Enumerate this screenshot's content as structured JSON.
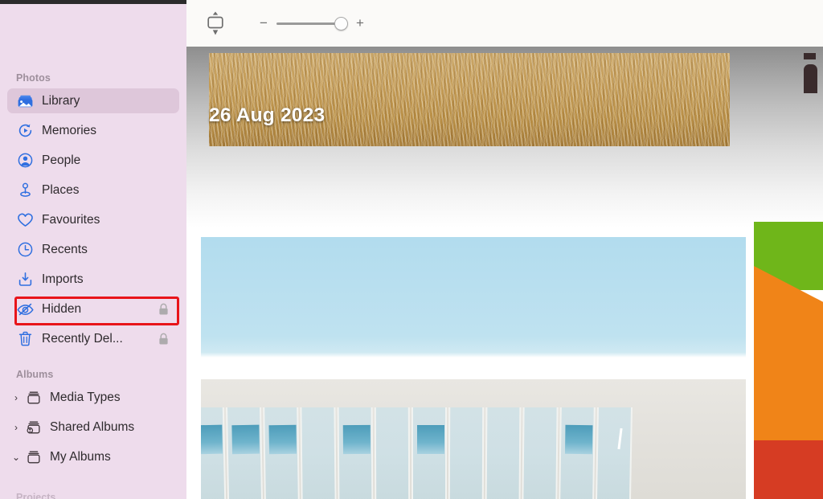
{
  "app": {
    "name": "Photos"
  },
  "sidebar": {
    "sections": [
      {
        "title": "Photos",
        "items": [
          {
            "label": "Library",
            "icon": "library-icon",
            "selected": true,
            "locked": false
          },
          {
            "label": "Memories",
            "icon": "memories-icon",
            "selected": false,
            "locked": false
          },
          {
            "label": "People",
            "icon": "people-icon",
            "selected": false,
            "locked": false
          },
          {
            "label": "Places",
            "icon": "places-icon",
            "selected": false,
            "locked": false
          },
          {
            "label": "Favourites",
            "icon": "heart-icon",
            "selected": false,
            "locked": false
          },
          {
            "label": "Recents",
            "icon": "clock-icon",
            "selected": false,
            "locked": false
          },
          {
            "label": "Imports",
            "icon": "import-icon",
            "selected": false,
            "locked": false
          },
          {
            "label": "Hidden",
            "icon": "eye-slash-icon",
            "selected": false,
            "locked": true
          },
          {
            "label": "Recently Del...",
            "icon": "trash-icon",
            "selected": false,
            "locked": true
          }
        ]
      },
      {
        "title": "Albums",
        "items": [
          {
            "label": "Media Types",
            "icon": "album-icon",
            "chevron": "›",
            "expanded": false
          },
          {
            "label": "Shared Albums",
            "icon": "shared-album-icon",
            "chevron": "›",
            "expanded": false
          },
          {
            "label": "My Albums",
            "icon": "album-icon",
            "chevron": "⌄",
            "expanded": true
          }
        ]
      }
    ],
    "partial_next_section": "Projects"
  },
  "toolbar": {
    "aspect_button_name": "zoom-level-stepper",
    "zoom_out_label": "−",
    "zoom_in_label": "+",
    "slider_value": 82
  },
  "content": {
    "photos": [
      {
        "name": "wheat-field-photo",
        "date_label": "26 Aug 2023"
      },
      {
        "name": "brick-building-photo",
        "date_label": ""
      },
      {
        "name": "modern-building-photo",
        "date_label": ""
      },
      {
        "name": "colour-blocks-photo",
        "date_label": ""
      }
    ],
    "date_label": "26 Aug 2023"
  },
  "annotation": {
    "target": "Hidden",
    "box_color": "#e8141a"
  },
  "colors": {
    "sidebar_bg": "#eedcec",
    "sidebar_selected": "#dec7da",
    "accent_blue": "#2f6fe0",
    "highlight_red": "#e8141a",
    "section_header": "#9e8f9c",
    "photo_green": "#6fb61a",
    "photo_orange": "#f08418",
    "photo_red": "#d63c23",
    "sky_blue": "#b2dcee"
  }
}
